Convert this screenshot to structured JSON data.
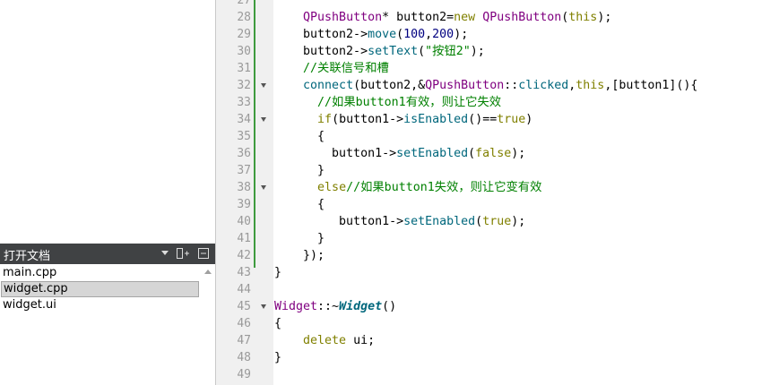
{
  "open_docs": {
    "title": "打开文档",
    "files": [
      "main.cpp",
      "widget.cpp",
      "widget.ui"
    ],
    "selected_index": 1
  },
  "editor": {
    "line_numbers": [
      "27",
      "28",
      "29",
      "30",
      "31",
      "32",
      "33",
      "34",
      "35",
      "36",
      "37",
      "38",
      "39",
      "40",
      "41",
      "42",
      "43",
      "44",
      "45",
      "46",
      "47",
      "48",
      "49"
    ],
    "fold_lines": [
      "32",
      "34",
      "38",
      "45"
    ],
    "lines": [
      [],
      [
        {
          "t": "    "
        },
        {
          "t": "QPushButton",
          "c": "k-type"
        },
        {
          "t": "* button2="
        },
        {
          "t": "new",
          "c": "k-kw"
        },
        {
          "t": " "
        },
        {
          "t": "QPushButton",
          "c": "k-type"
        },
        {
          "t": "("
        },
        {
          "t": "this",
          "c": "k-kw"
        },
        {
          "t": ");"
        }
      ],
      [
        {
          "t": "    button2->"
        },
        {
          "t": "move",
          "c": "k-fn"
        },
        {
          "t": "("
        },
        {
          "t": "100",
          "c": "k-num"
        },
        {
          "t": ","
        },
        {
          "t": "200",
          "c": "k-num"
        },
        {
          "t": ");"
        }
      ],
      [
        {
          "t": "    button2->"
        },
        {
          "t": "setText",
          "c": "k-fn"
        },
        {
          "t": "("
        },
        {
          "t": "\"按钮2\"",
          "c": "k-str"
        },
        {
          "t": ");"
        }
      ],
      [
        {
          "t": "    "
        },
        {
          "t": "//关联信号和槽",
          "c": "k-cmt"
        }
      ],
      [
        {
          "t": "    "
        },
        {
          "t": "connect",
          "c": "k-fn"
        },
        {
          "t": "(button2,&"
        },
        {
          "t": "QPushButton",
          "c": "k-type"
        },
        {
          "t": "::"
        },
        {
          "t": "clicked",
          "c": "k-fn"
        },
        {
          "t": ","
        },
        {
          "t": "this",
          "c": "k-kw"
        },
        {
          "t": ",[button1](){"
        }
      ],
      [
        {
          "t": "      "
        },
        {
          "t": "//如果button1有效，则让它失效",
          "c": "k-cmt"
        }
      ],
      [
        {
          "t": "      "
        },
        {
          "t": "if",
          "c": "k-kw"
        },
        {
          "t": "(button1->"
        },
        {
          "t": "isEnabled",
          "c": "k-fn"
        },
        {
          "t": "()=="
        },
        {
          "t": "true",
          "c": "k-kw"
        },
        {
          "t": ")"
        }
      ],
      [
        {
          "t": "      {"
        }
      ],
      [
        {
          "t": "        button1->"
        },
        {
          "t": "setEnabled",
          "c": "k-fn"
        },
        {
          "t": "("
        },
        {
          "t": "false",
          "c": "k-kw"
        },
        {
          "t": ");"
        }
      ],
      [
        {
          "t": "      }"
        }
      ],
      [
        {
          "t": "      "
        },
        {
          "t": "else",
          "c": "k-kw"
        },
        {
          "t": "//如果button1失效，则让它变有效",
          "c": "k-cmt"
        }
      ],
      [
        {
          "t": "      {"
        }
      ],
      [
        {
          "t": "         button1->"
        },
        {
          "t": "setEnabled",
          "c": "k-fn"
        },
        {
          "t": "("
        },
        {
          "t": "true",
          "c": "k-kw"
        },
        {
          "t": ");"
        }
      ],
      [
        {
          "t": "      }"
        }
      ],
      [
        {
          "t": "    });"
        }
      ],
      [
        {
          "t": "}"
        }
      ],
      [],
      [
        {
          "t": "Widget",
          "c": "k-type"
        },
        {
          "t": "::~"
        },
        {
          "t": "Widget",
          "c": "k-ital"
        },
        {
          "t": "()"
        }
      ],
      [
        {
          "t": "{"
        }
      ],
      [
        {
          "t": "    "
        },
        {
          "t": "delete",
          "c": "k-kw"
        },
        {
          "t": " ui;"
        }
      ],
      [
        {
          "t": "}"
        }
      ],
      []
    ]
  }
}
